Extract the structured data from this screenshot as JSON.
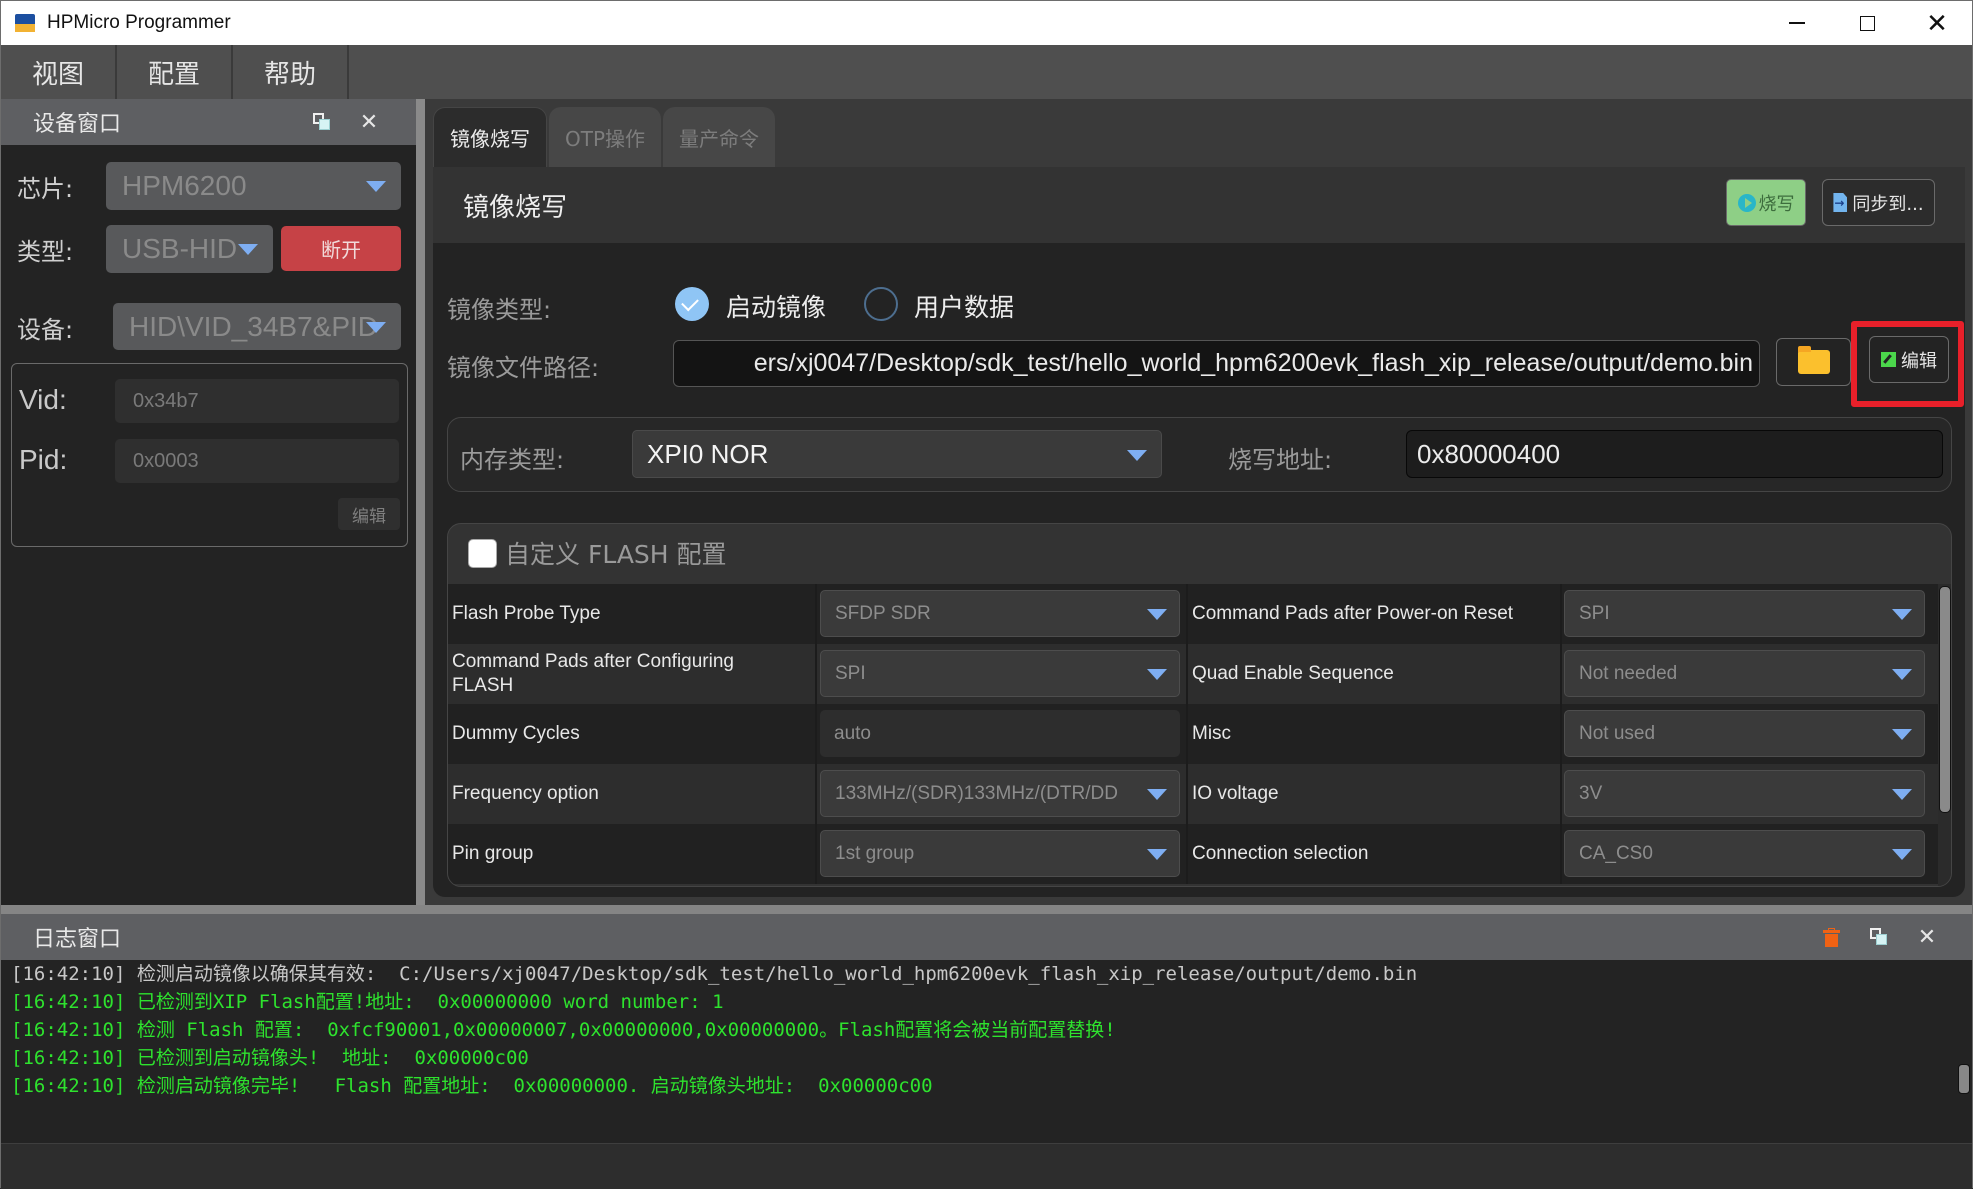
{
  "window": {
    "title": "HPMicro Programmer",
    "controls": [
      "minimize",
      "maximize",
      "close"
    ]
  },
  "menu": [
    "视图",
    "配置",
    "帮助"
  ],
  "device_window": {
    "title": "设备窗口",
    "chip_label": "芯片:",
    "chip_value": "HPM6200",
    "type_label": "类型:",
    "type_value": "USB-HID",
    "disconnect_button": "断开",
    "device_label": "设备:",
    "device_value": "HID\\VID_34B7&PID",
    "vid_label": "Vid:",
    "vid_value": "0x34b7",
    "pid_label": "Pid:",
    "pid_value": "0x0003",
    "edit_button": "编辑"
  },
  "tabs": [
    {
      "label": "镜像烧写",
      "active": true
    },
    {
      "label": "OTP操作",
      "active": false
    },
    {
      "label": "量产命令",
      "active": false
    }
  ],
  "image_write": {
    "heading": "镜像烧写",
    "burn_button": "烧写",
    "sync_button": "同步到...",
    "image_type_label": "镜像类型:",
    "image_type_options": [
      {
        "label": "启动镜像",
        "selected": true
      },
      {
        "label": "用户数据",
        "selected": false
      }
    ],
    "file_path_label": "镜像文件路径:",
    "file_path_value": "ers/xj0047/Desktop/sdk_test/hello_world_hpm6200evk_flash_xip_release/output/demo.bin",
    "edit_button": "编辑",
    "memory_type_label": "内存类型:",
    "memory_type_value": "XPI0 NOR",
    "write_address_label": "烧写地址:",
    "write_address_value": "0x80000400",
    "custom_flash_label": "自定义 FLASH 配置",
    "custom_flash_checked": false,
    "flash_config": [
      {
        "left_label": "Flash Probe Type",
        "left_value": "SFDP SDR",
        "left_kind": "combo",
        "right_label": "Command Pads after Power-on Reset",
        "right_value": "SPI"
      },
      {
        "left_label": "Command Pads after Configuring FLASH",
        "left_value": "SPI",
        "left_kind": "combo",
        "right_label": "Quad Enable Sequence",
        "right_value": "Not needed"
      },
      {
        "left_label": "Dummy Cycles",
        "left_value": "auto",
        "left_kind": "input",
        "right_label": "Misc",
        "right_value": "Not used"
      },
      {
        "left_label": "Frequency option",
        "left_value": "133MHz/(SDR)133MHz/(DTR/DD",
        "left_kind": "combo",
        "right_label": "IO voltage",
        "right_value": "3V"
      },
      {
        "left_label": "Pin group",
        "left_value": "1st group",
        "left_kind": "combo",
        "right_label": "Connection selection",
        "right_value": "CA_CS0"
      }
    ]
  },
  "log_window": {
    "title": "日志窗口",
    "lines": [
      {
        "text": "[16:42:10] 检测启动镜像以确保其有效:  C:/Users/xj0047/Desktop/sdk_test/hello_world_hpm6200evk_flash_xip_release/output/demo.bin",
        "color": "#c8c8c8"
      },
      {
        "text": "[16:42:10] 已检测到XIP Flash配置!地址:  0x00000000 word number: 1",
        "color": "#2ee22e"
      },
      {
        "text": "[16:42:10] 检测 Flash 配置:  0xfcf90001,0x00000007,0x00000000,0x00000000。Flash配置将会被当前配置替换!",
        "color": "#2ee22e"
      },
      {
        "text": "[16:42:10] 已检测到启动镜像头!  地址:  0x00000c00",
        "color": "#2ee22e"
      },
      {
        "text": "[16:42:10] 检测启动镜像完毕!   Flash 配置地址:  0x00000000. 启动镜像头地址:  0x00000c00",
        "color": "#2ee22e"
      }
    ]
  },
  "colors": {
    "accent_blue": "#7eaef2",
    "disconnect_red": "#c64246",
    "burn_green": "#8ecf86",
    "highlight_red": "#e8202a",
    "log_green": "#2ee22e",
    "trash_orange": "#f06214"
  }
}
